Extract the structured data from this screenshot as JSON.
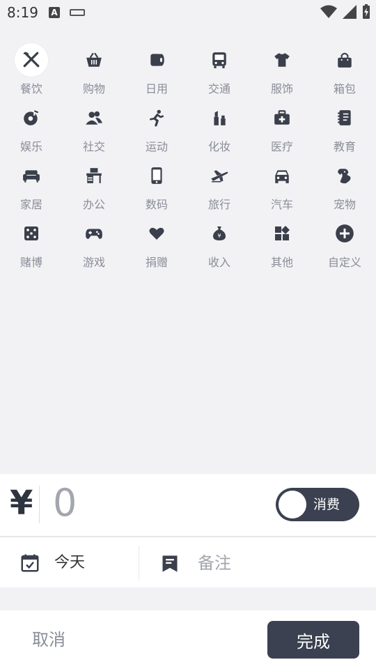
{
  "status_bar": {
    "time": "8:19",
    "input_indicator": "A"
  },
  "categories": [
    {
      "label": "餐饮",
      "icon": "utensils-icon",
      "selected": true
    },
    {
      "label": "购物",
      "icon": "basket-icon"
    },
    {
      "label": "日用",
      "icon": "toilet-paper-icon"
    },
    {
      "label": "交通",
      "icon": "bus-icon"
    },
    {
      "label": "服饰",
      "icon": "tshirt-icon"
    },
    {
      "label": "箱包",
      "icon": "bag-icon"
    },
    {
      "label": "娱乐",
      "icon": "music-disc-icon"
    },
    {
      "label": "社交",
      "icon": "users-icon"
    },
    {
      "label": "运动",
      "icon": "running-icon"
    },
    {
      "label": "化妆",
      "icon": "lipstick-icon"
    },
    {
      "label": "医疗",
      "icon": "medical-kit-icon"
    },
    {
      "label": "教育",
      "icon": "notebook-icon"
    },
    {
      "label": "家居",
      "icon": "sofa-icon"
    },
    {
      "label": "办公",
      "icon": "office-desk-icon"
    },
    {
      "label": "数码",
      "icon": "phone-icon"
    },
    {
      "label": "旅行",
      "icon": "airplane-icon"
    },
    {
      "label": "汽车",
      "icon": "car-icon"
    },
    {
      "label": "宠物",
      "icon": "dog-icon"
    },
    {
      "label": "赌博",
      "icon": "dice-icon"
    },
    {
      "label": "游戏",
      "icon": "gamepad-icon"
    },
    {
      "label": "捐赠",
      "icon": "heart-icon"
    },
    {
      "label": "收入",
      "icon": "money-bag-icon"
    },
    {
      "label": "其他",
      "icon": "widgets-icon"
    },
    {
      "label": "自定义",
      "icon": "add-circle-icon"
    }
  ],
  "amount": {
    "currency_symbol": "¥",
    "value": "0"
  },
  "type_toggle": {
    "label": "消费",
    "on": false
  },
  "date": {
    "label": "今天"
  },
  "note": {
    "placeholder": "备注"
  },
  "actions": {
    "cancel_label": "取消",
    "done_label": "完成"
  },
  "colors": {
    "accent": "#3b4150",
    "icon": "#3a3f4b",
    "label": "#8a8d97",
    "background": "#f2f2f5"
  }
}
